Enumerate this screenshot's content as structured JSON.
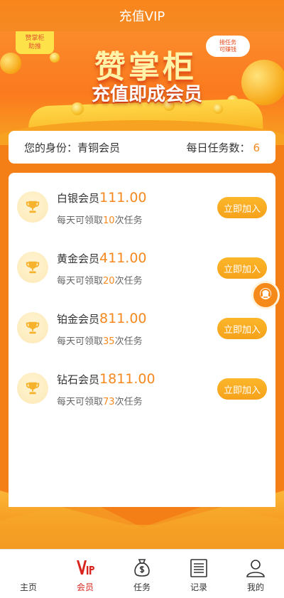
{
  "header": {
    "title": "充值VIP"
  },
  "banner": {
    "tag_line1": "赞掌柜",
    "tag_line2": "助推",
    "title": "赞掌柜",
    "subtitle": "充值即成会员",
    "bubble_line1": "接任务",
    "bubble_line2": "可赚钱"
  },
  "identity": {
    "label": "您的身份：",
    "value": "青铜会员",
    "tasks_label": "每日任务数：",
    "tasks_value": "6"
  },
  "members": [
    {
      "name": "白银会员",
      "price": "111.00",
      "desc_prefix": "每天可领取",
      "count": "10",
      "desc_suffix": "次任务",
      "button": "立即加入"
    },
    {
      "name": "黄金会员",
      "price": "411.00",
      "desc_prefix": "每天可领取",
      "count": "20",
      "desc_suffix": "次任务",
      "button": "立即加入"
    },
    {
      "name": "铂金会员",
      "price": "811.00",
      "desc_prefix": "每天可领取",
      "count": "35",
      "desc_suffix": "次任务",
      "button": "立即加入"
    },
    {
      "name": "钻石会员",
      "price": "1811.00",
      "desc_prefix": "每天可领取",
      "count": "73",
      "desc_suffix": "次任务",
      "button": "立即加入"
    }
  ],
  "tabbar": [
    {
      "label": "主页",
      "icon": "home-icon",
      "active": false
    },
    {
      "label": "会员",
      "icon": "vip-icon",
      "active": true
    },
    {
      "label": "任务",
      "icon": "money-bag-icon",
      "active": false
    },
    {
      "label": "记录",
      "icon": "record-icon",
      "active": false
    },
    {
      "label": "我的",
      "icon": "user-icon",
      "active": false
    }
  ],
  "fab": {
    "icon": "customer-service-icon"
  },
  "colors": {
    "accent": "#f5881f",
    "button": "#f6a21b",
    "active_tab": "#d8261e",
    "background": "#f57f17"
  }
}
